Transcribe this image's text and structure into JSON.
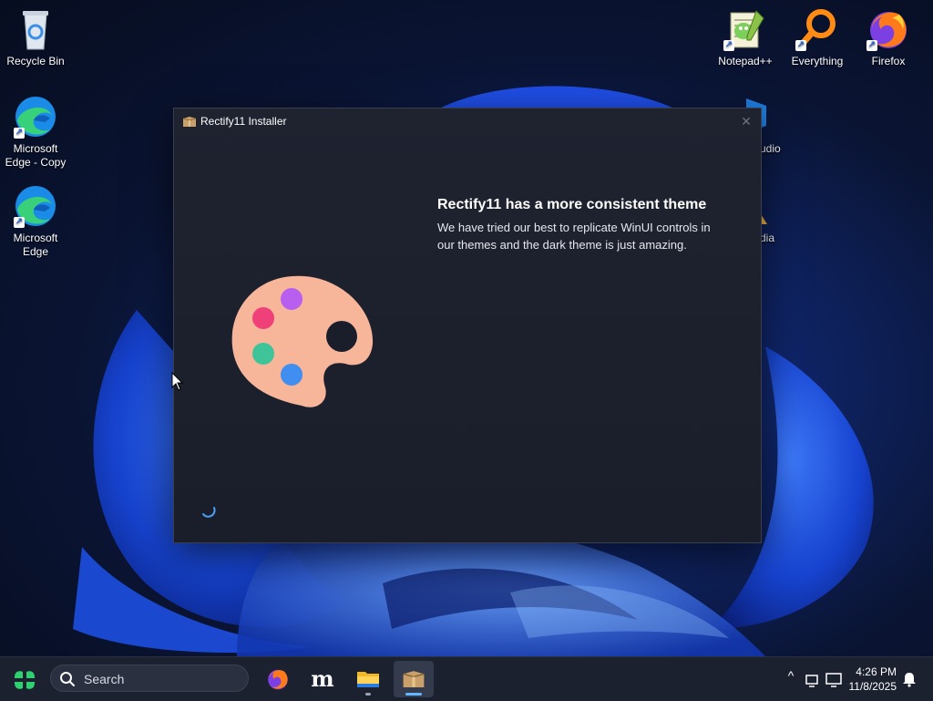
{
  "desktop": {
    "icons": [
      {
        "label": "Recycle Bin"
      },
      {
        "label": "Microsoft Edge - Copy"
      },
      {
        "label": "Microsoft Edge"
      },
      {
        "label": "Notepad++"
      },
      {
        "label": "Everything"
      },
      {
        "label": "Firefox"
      }
    ],
    "partial_labels": [
      "udio",
      "dia"
    ]
  },
  "window": {
    "title": "Rectify11 Installer",
    "close_glyph": "✕",
    "headline": "Rectify11 has a more consistent theme",
    "description": "We have tried our best to replicate WinUI controls in our themes and the dark theme is just amazing.",
    "illustration": "paint-palette"
  },
  "taskbar": {
    "search_placeholder": "Search",
    "apps": [
      {
        "name": "firefox-icon"
      },
      {
        "name": "moodle-icon",
        "glyph": "m"
      },
      {
        "name": "file-explorer-icon"
      },
      {
        "name": "rectify11-installer-icon",
        "active": true
      }
    ],
    "tray": {
      "chevron": "^",
      "time": "4:26 PM",
      "date": "11/8/2025"
    }
  },
  "colors": {
    "window_bg": "#1f2330",
    "accent": "#62b8ff",
    "palette_body": "#f7b59a"
  }
}
